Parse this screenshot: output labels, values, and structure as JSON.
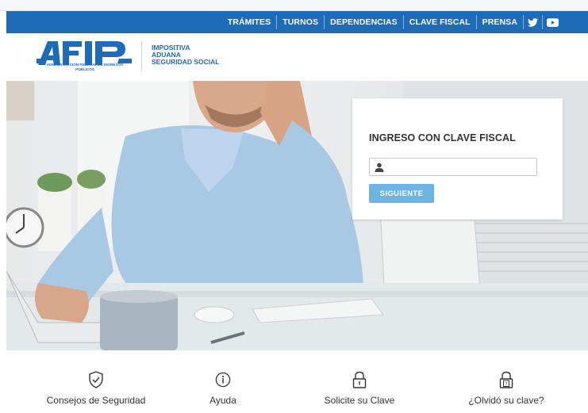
{
  "nav": {
    "items": [
      "TRÁMITES",
      "TURNOS",
      "DEPENDENCIAS",
      "CLAVE FISCAL",
      "PRENSA"
    ],
    "icons": [
      "twitter-icon",
      "youtube-icon"
    ]
  },
  "header": {
    "logo_caption": "ADMINISTRACIÓN FEDERAL DE INGRESOS PÚBLICOS",
    "tagline": [
      "IMPOSITIVA",
      "ADUANA",
      "SEGURIDAD SOCIAL"
    ]
  },
  "login": {
    "title": "INGRESO CON CLAVE FISCAL",
    "input_value": "",
    "button_label": "SIGUIENTE"
  },
  "features": [
    {
      "label": "Consejos de Seguridad",
      "icon": "shield-check-icon"
    },
    {
      "label": "Ayuda",
      "icon": "info-icon"
    },
    {
      "label": "Solicite su Clave",
      "icon": "lock-icon"
    },
    {
      "label": "¿Olvidó su clave?",
      "icon": "lock-question-icon"
    }
  ],
  "colors": {
    "brand_blue": "#1e6cb8",
    "button_light_blue": "#6cb4e1"
  }
}
